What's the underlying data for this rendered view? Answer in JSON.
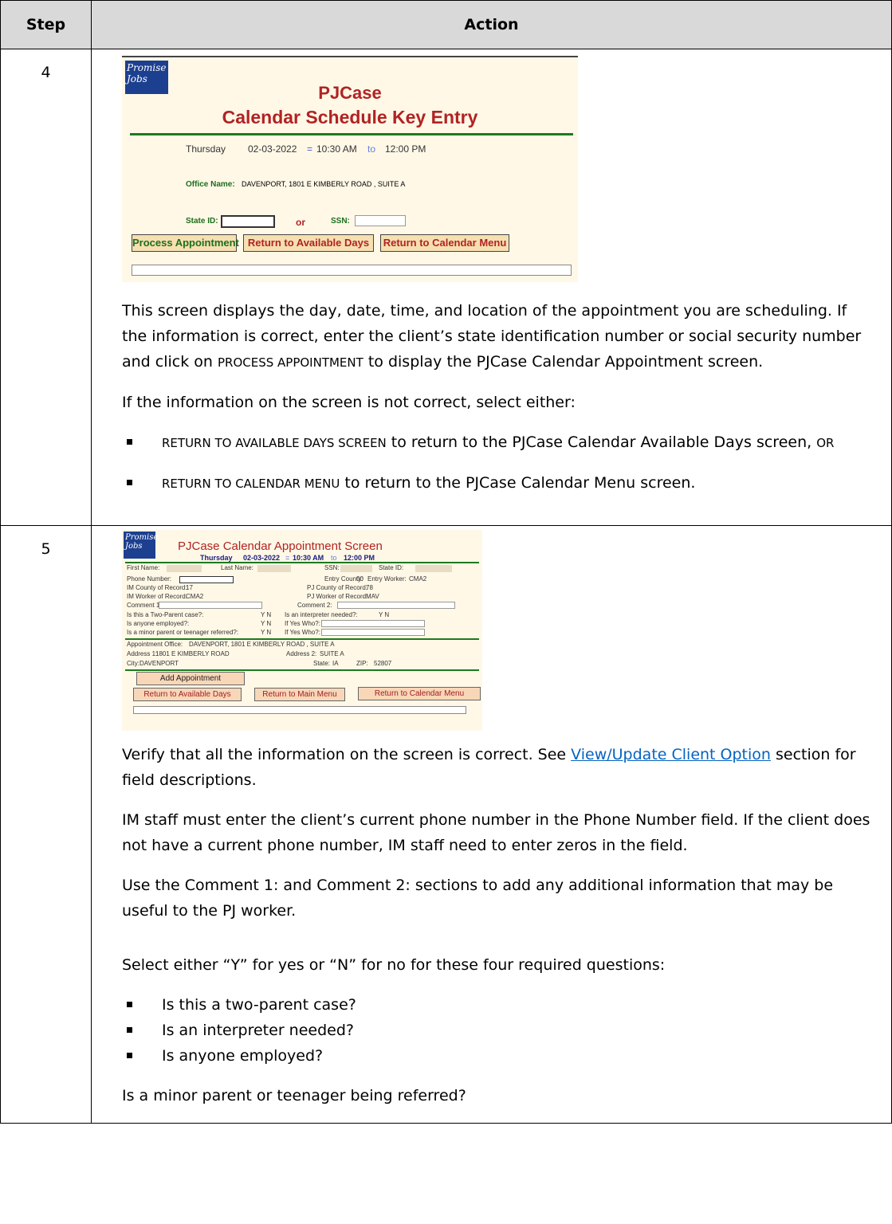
{
  "headers": {
    "step": "Step",
    "action": "Action"
  },
  "step4": {
    "number": "4",
    "screenshot": {
      "logo_text": "Promise Jobs",
      "title1": "PJCase",
      "title2": "Calendar Schedule Key Entry",
      "day": "Thursday",
      "date": "02-03-2022",
      "time_start": "10:30 AM",
      "to": "to",
      "time_end": "12:00 PM",
      "office_label": "Office Name:",
      "office_value": "DAVENPORT, 1801 E KIMBERLY ROAD , SUITE A",
      "state_id_label": "State ID:",
      "or": "or",
      "ssn_label": "SSN:",
      "btn_process": "Process Appointment",
      "btn_days": "Return to Available Days",
      "btn_menu": "Return to Calendar Menu"
    },
    "p1a": "This screen displays the day, date, time, and location of the appointment you are scheduling. If the information is correct, enter the client’s state identification number or social security number and click on ",
    "p1b": "PROCESS APPOINTMENT",
    "p1c": " to display the PJCase Calendar Appointment screen.",
    "p2": "If the information on the screen is not correct, select either:",
    "b1a": "RETURN TO AVAILABLE DAYS SCREEN",
    "b1b": " to return to the PJCase Calendar Available Days screen, ",
    "b1c": "OR",
    "b2a": "RETURN TO CALENDAR MENU",
    "b2b": " to return to the PJCase Calendar Menu screen."
  },
  "step5": {
    "number": "5",
    "screenshot": {
      "logo_text": "Promise Jobs",
      "title": "PJCase Calendar Appointment Screen",
      "day": "Thursday",
      "date": "02-03-2022",
      "time_start": "10:30 AM",
      "to": "to",
      "time_end": "12:00 PM",
      "first_name": "First Name:",
      "last_name": "Last Name:",
      "ssn": "SSN:",
      "state_id": "State ID:",
      "phone": "Phone Number:",
      "entry_county": "Entry County:",
      "entry_county_val": "00",
      "entry_worker": "Entry Worker:",
      "entry_worker_val": "CMA2",
      "im_county": "IM County of Record:",
      "im_county_val": "17",
      "pj_county": "PJ County of Record:",
      "pj_county_val": "78",
      "im_worker": "IM Worker of Record:",
      "im_worker_val": "CMA2",
      "pj_worker": "PJ Worker of Record:",
      "pj_worker_val": "MAV",
      "comment1": "Comment 1:",
      "comment2": "Comment 2:",
      "q1": "Is this a Two-Parent case?:",
      "q2": "Is anyone employed?:",
      "q3": "Is a minor parent or teenager referred?:",
      "q4": "Is an interpreter needed?:",
      "ifyes1": "If Yes Who?:",
      "ifyes2": "If Yes Who?:",
      "yn": "Y  N",
      "appt_office": "Appointment Office:",
      "appt_office_val": "DAVENPORT, 1801 E KIMBERLY ROAD , SUITE A",
      "addr1": "Address 1:",
      "addr1_val": "1801 E KIMBERLY ROAD",
      "addr2": "Address 2:",
      "addr2_val": "SUITE A",
      "city": "City:",
      "city_val": "DAVENPORT",
      "state": "State:",
      "state_val": "IA",
      "zip": "ZIP:",
      "zip_val": "52807",
      "btn_add": "Add Appointment",
      "btn_days": "Return to Available Days",
      "btn_main": "Return to Main Menu",
      "btn_menu": "Return to Calendar Menu"
    },
    "p1a": "Verify that all the information on the screen is correct. See ",
    "p1_link": "View/Update Client Option",
    "p1b": " section for field descriptions.",
    "p2": "IM staff must enter the client’s current phone number in the Phone Number field. If the client does not have a current phone number, IM staff need to enter zeros in the field.",
    "p3": "Use the Comment 1: and Comment 2: sections to add any additional information that may be useful to the PJ worker.",
    "p4": "Select either “Y” for yes or “N” for no for these four required questions:",
    "bullets": [
      "Is this a two-parent case?",
      "Is an interpreter needed?",
      "Is anyone employed?"
    ],
    "p5": "Is a minor parent or teenager being referred?"
  }
}
